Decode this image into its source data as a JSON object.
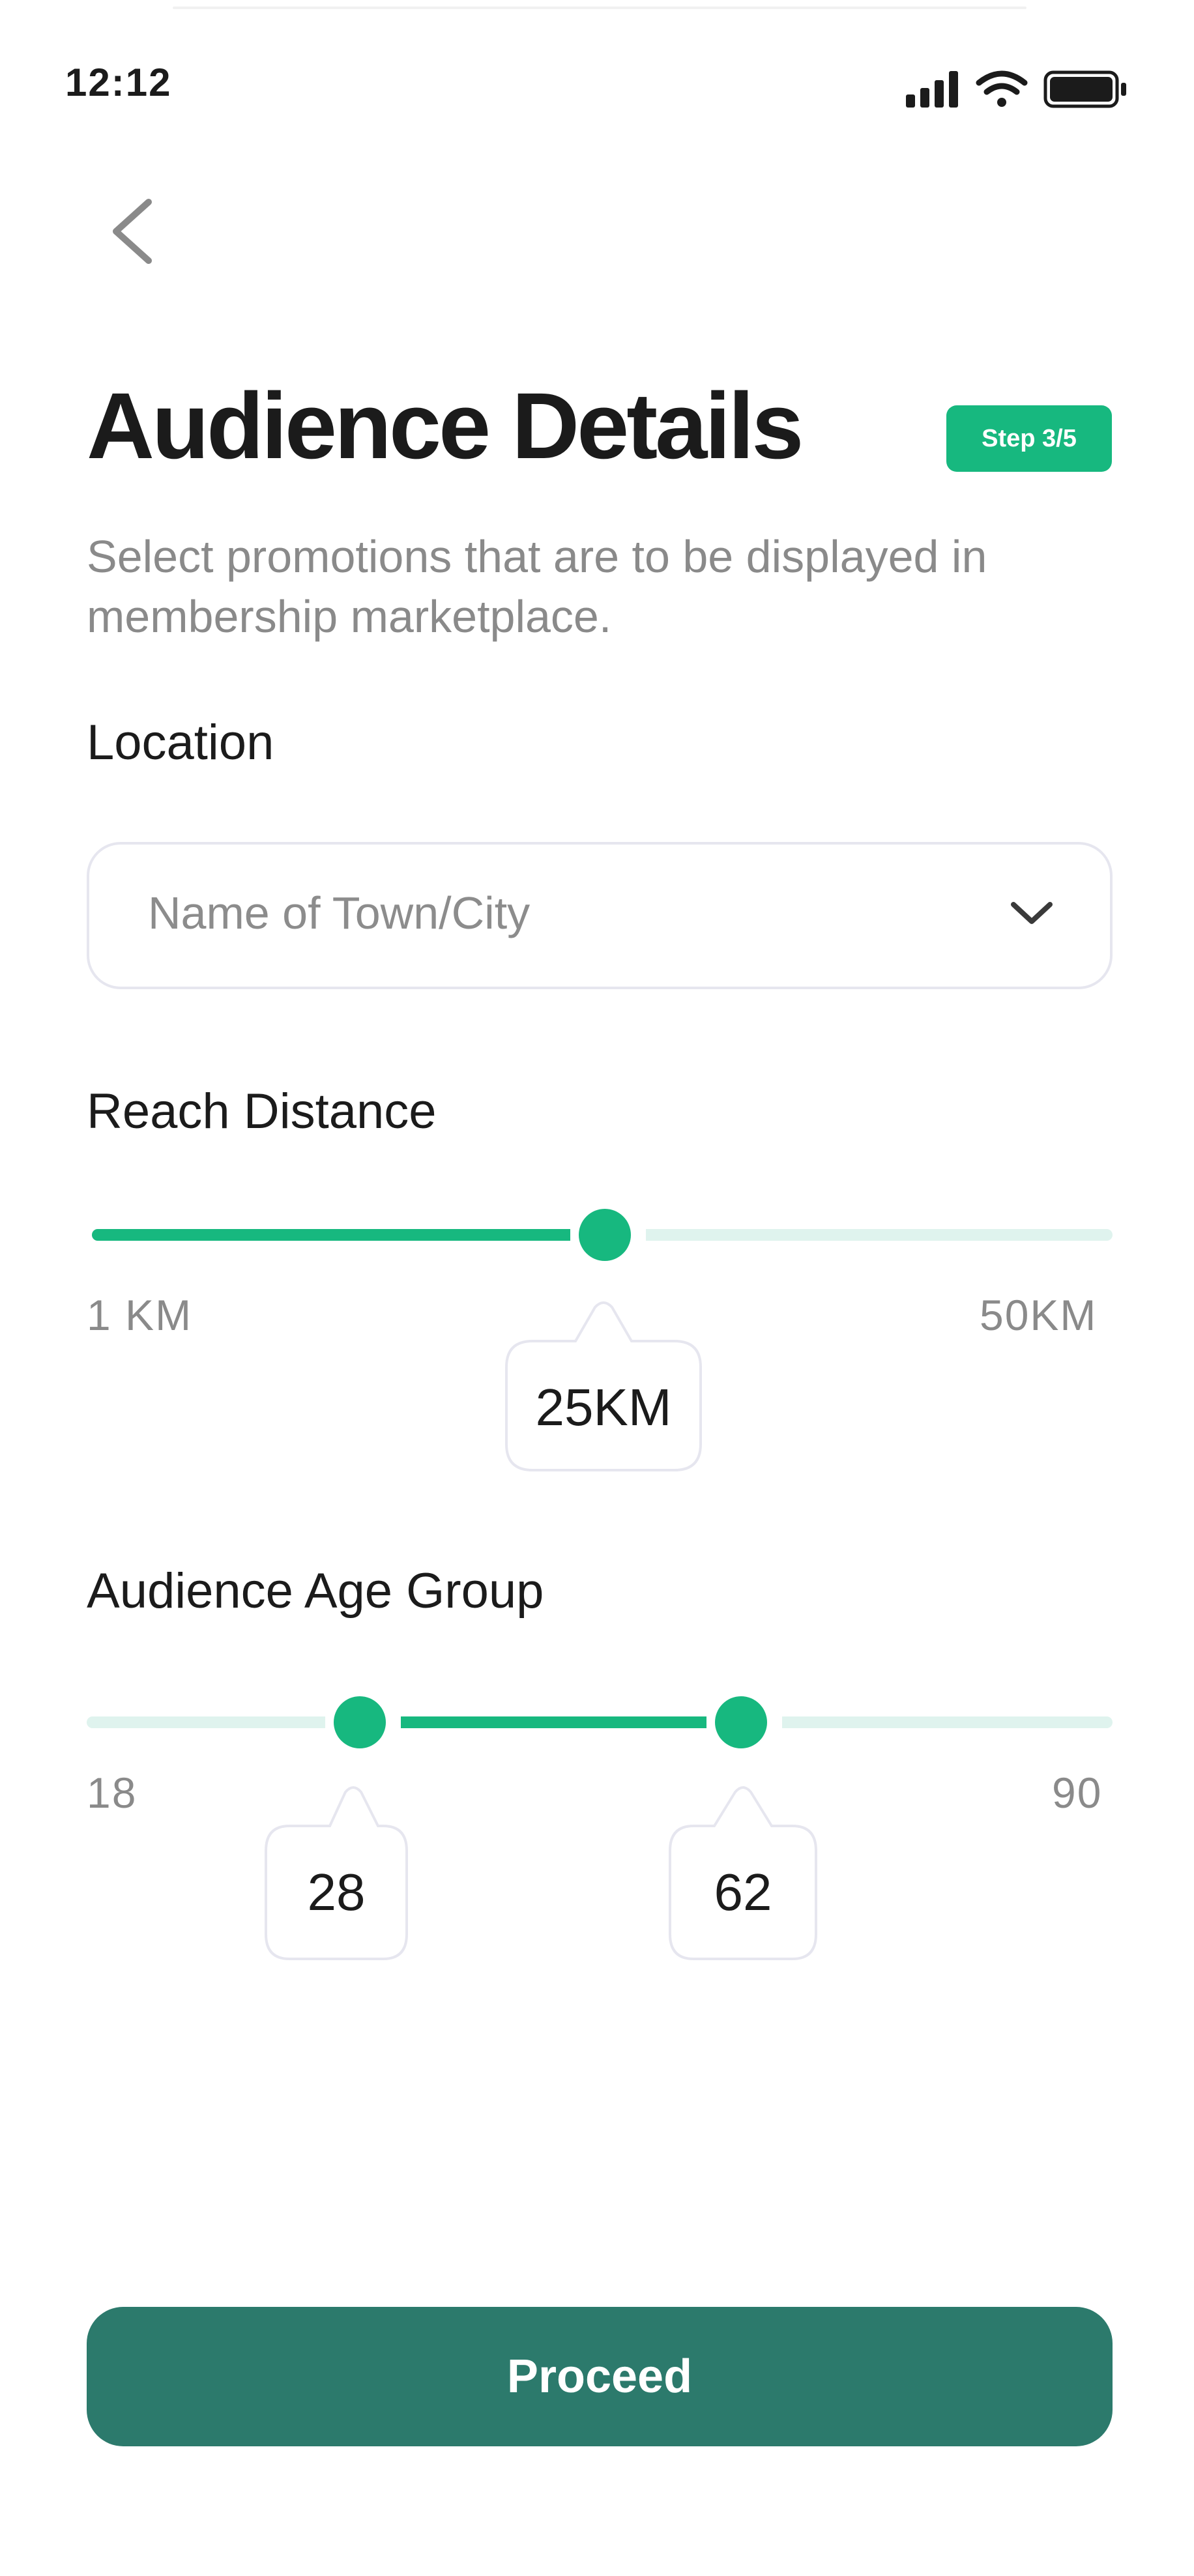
{
  "status_bar": {
    "time": "12:12",
    "icons": [
      "signal-icon",
      "wifi-icon",
      "battery-icon"
    ]
  },
  "header": {
    "back_icon": "chevron-left-icon",
    "title": "Audience Details",
    "step_badge": "Step 3/5",
    "subtitle": "Select promotions that are to be displayed in membership marketplace."
  },
  "location": {
    "label": "Location",
    "placeholder": "Name of Town/City",
    "chevron_icon": "chevron-down-icon"
  },
  "reach_distance": {
    "label": "Reach Distance",
    "min_label": "1 KM",
    "max_label": "50KM",
    "value_label": "25KM",
    "min": 1,
    "max": 50,
    "value": 25
  },
  "age_group": {
    "label": "Audience Age Group",
    "min_label": "18",
    "max_label": "90",
    "low_label": "28",
    "high_label": "62",
    "min": 18,
    "max": 90,
    "low": 28,
    "high": 62
  },
  "actions": {
    "proceed_label": "Proceed"
  },
  "colors": {
    "accent": "#17b87f",
    "track": "#dff3ee",
    "button": "#2c7a6c",
    "muted_text": "#8a8a8a"
  }
}
